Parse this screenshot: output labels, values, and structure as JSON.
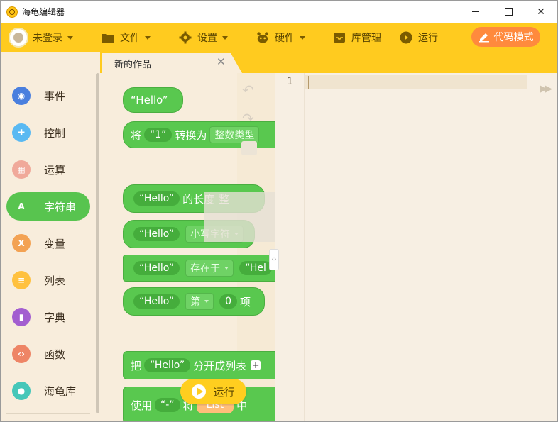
{
  "window": {
    "title": "海龟编辑器"
  },
  "toolbar": {
    "login": "未登录",
    "file": "文件",
    "settings": "设置",
    "hardware": "硬件",
    "library": "库管理",
    "run": "运行",
    "code_mode": "代码模式"
  },
  "colors": {
    "toolbar": "#ffcb1f",
    "active_category": "#58c44f",
    "block": "#59c84f",
    "code_button": "#ff8a3d"
  },
  "sidebar": {
    "items": [
      {
        "label": "事件",
        "icon": "toggle-icon",
        "color": "#4a7fde"
      },
      {
        "label": "控制",
        "icon": "gamepad-icon",
        "color": "#5ab9f2"
      },
      {
        "label": "运算",
        "icon": "calculator-icon",
        "color": "#f0a99a"
      },
      {
        "label": "字符串",
        "icon": "letter-a-icon",
        "color": "#58c44f"
      },
      {
        "label": "变量",
        "icon": "variable-x-icon",
        "color": "#f3a253"
      },
      {
        "label": "列表",
        "icon": "list-icon",
        "color": "#ffc13f"
      },
      {
        "label": "字典",
        "icon": "book-icon",
        "color": "#a35ed0"
      },
      {
        "label": "函数",
        "icon": "code-icon",
        "color": "#ee8566"
      },
      {
        "label": "海龟库",
        "icon": "turtle-icon",
        "color": "#46c7b9"
      }
    ]
  },
  "tabs": [
    {
      "label": "新的作品"
    }
  ],
  "blocks": {
    "hello": "“Hello”",
    "convert_prefix": "将",
    "convert_value": "“1”",
    "convert_mid": "转换为",
    "convert_type": "整数类型",
    "length_suffix": "的长度",
    "length_trail": "整",
    "lowercase_option": "小写字符",
    "contains_option": "存在于",
    "contains_right": "“Hel",
    "index_prefix": "第",
    "index_value": "0",
    "index_suffix": "项",
    "split_prefix": "把",
    "split_suffix": "分开成列表",
    "use_prefix": "使用",
    "use_sep": "“-”",
    "use_mid": "将",
    "use_list": "List",
    "use_trail": "中"
  },
  "editor": {
    "line_number": "1"
  },
  "run_button": {
    "label": "运行"
  }
}
